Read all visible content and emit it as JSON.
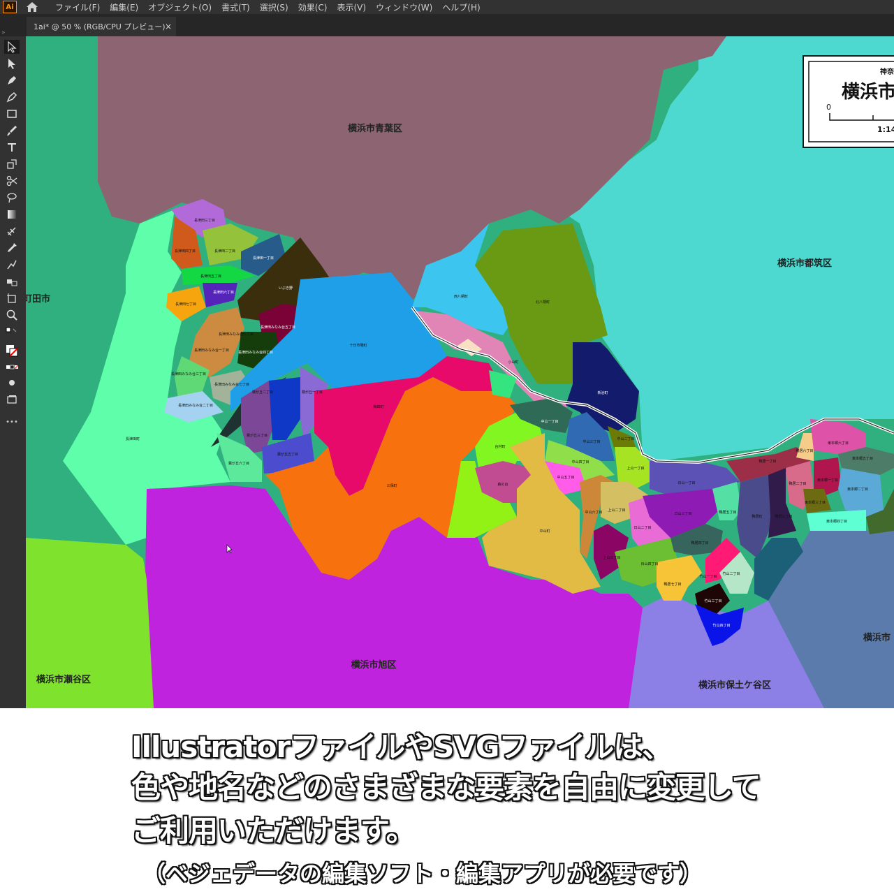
{
  "app": {
    "logo": "Ai",
    "menu": [
      "ファイル(F)",
      "編集(E)",
      "オブジェクト(O)",
      "書式(T)",
      "選択(S)",
      "効果(C)",
      "表示(V)",
      "ウィンドウ(W)",
      "ヘルプ(H)"
    ],
    "tab_title": "1ai* @ 50 % (RGB/CPU プレビュー)",
    "tab_close": "×",
    "tools": [
      "selection-tool-icon",
      "direct-selection-tool-icon",
      "pen-tool-icon",
      "curvature-tool-icon",
      "rectangle-tool-icon",
      "paintbrush-tool-icon",
      "type-tool-icon",
      "scale-tool-icon",
      "scissors-tool-icon",
      "lasso-tool-icon",
      "gradient-tool-icon",
      "eyedropper-tool-icon",
      "width-tool-icon",
      "blend-tool-icon",
      "symbol-tool-icon",
      "artboard-tool-icon",
      "zoom-tool-icon"
    ],
    "more_tools": "•••"
  },
  "map": {
    "big_labels": {
      "aoba": "横浜市青葉区",
      "tsuzuki": "横浜市都筑区",
      "machida": "町田市",
      "seya": "横浜市瀬谷区",
      "asahi": "横浜市旭区",
      "hodogaya": "横浜市保土ケ谷区",
      "kanagawa": "横浜市"
    },
    "legend": {
      "prefecture": "神奈",
      "city": "横浜市",
      "scale_zero": "0",
      "scale_ratio": "1:14"
    },
    "small_labels": {
      "nagatsuta3": "長津田三丁目",
      "nagatsuta4": "長津田四丁目",
      "nagatsuta2": "長津田二丁目",
      "nagatsuta1": "長津田一丁目",
      "nagatsuta5": "長津田五丁目",
      "nagatsuta6": "長津田六丁目",
      "nagatsuta7": "長津田七丁目",
      "iibuki": "いぶき野",
      "minami5": "長津田みなみ台五丁目",
      "minami1": "長津田みなみ台一丁目",
      "minami3": "長津田みなみ台三丁目",
      "minami4": "長津田みなみ台四丁目",
      "minami6": "長津田みなみ台六丁目",
      "minami2": "長津田みなみ台二丁目",
      "minami7": "長津田みなみ台七丁目",
      "nagatsutacho": "長津田町",
      "tokaichiba": "十日市場町",
      "nishihassaku": "西八朔町",
      "kitahassaku": "北八朔町",
      "koyama": "小山町",
      "shinharu": "新治町",
      "kirigaoka1": "霧が丘一丁目",
      "kirigaoka2": "霧が丘二丁目",
      "kirigaoka3": "霧が丘三丁目",
      "kirigaoka4": "霧が丘四丁目",
      "kirigaoka5": "霧が丘五丁目",
      "kirigaoka6": "霧が丘六丁目",
      "baizuka": "梅田町",
      "miho": "三保町",
      "tainaka": "台村町",
      "kamo": "森の台",
      "nakayama": "中山町",
      "nakayama1": "中山一丁目",
      "nakayama2": "中山二丁目",
      "nakayama3": "中山三丁目",
      "nakayama4": "中山四丁目",
      "nakayama5": "中山五丁目",
      "nakayama6": "中山六丁目",
      "kamiyama1": "上山一丁目",
      "kamiyama2": "上山二丁目",
      "kamiyama3": "上山三丁目",
      "hiyama1": "日山一丁目",
      "hiyama2": "日山二丁目",
      "hiyama3": "日山三丁目",
      "hiyama4": "日山四丁目",
      "kamoi1": "鴨居一丁目",
      "kamoi2": "鴨居二丁目",
      "kamoi3": "鴨居三丁目",
      "kamoi4": "鴨居四丁目",
      "kamoi5": "鴨居五丁目",
      "kamoi6": "鴨居六丁目",
      "kamoi7": "鴨居七丁目",
      "kamoicho": "鴨居町",
      "higashihongo1": "東本郷一丁目",
      "higashihongo2": "東本郷二丁目",
      "higashihongo3": "東本郷三丁目",
      "higashihongo4": "東本郷四丁目",
      "higashihongo5": "東本郷五丁目",
      "higashihongo6": "東本郷六丁目",
      "takeyama1": "竹山一丁目",
      "takeyama2": "竹山二丁目",
      "takeyama3": "竹山三丁目",
      "takeyama4": "竹山四丁目"
    }
  },
  "caption": {
    "line1": "IllustratorファイルやSVGファイルは、",
    "line2": "色や地名などのさまざまな要素を自由に変更して",
    "line3": "ご利用いただけます。",
    "note": "（ベジェデータの編集ソフト・編集アプリが必要です）"
  },
  "colors": {
    "ui_dark": "#323232",
    "aoba": "#8c6472",
    "tsuzuki": "#4dd9d0",
    "asahi": "#c023dd",
    "seya": "#7fe22d",
    "hodogaya": "#8c7fe6",
    "kanagawa": "#5a7bab",
    "machida": "#2fb07e",
    "nagatsutacho": "#5efeaa",
    "tokaichiba": "#1f9fe8",
    "miho": "#f7720f",
    "shinharu": "#e80a6a"
  }
}
